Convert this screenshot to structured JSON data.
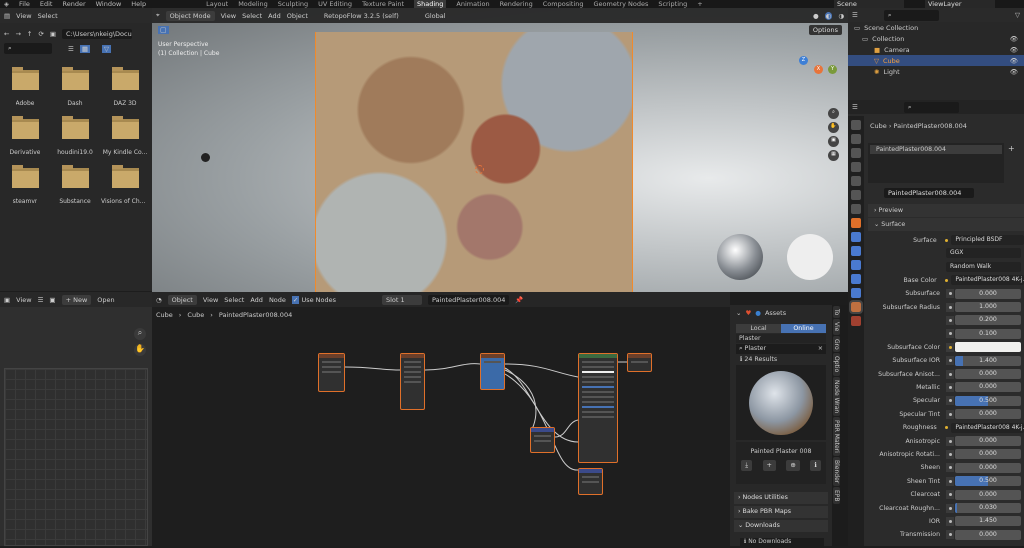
{
  "topbar": {
    "menus": [
      "File",
      "Edit",
      "Render",
      "Window",
      "Help"
    ],
    "workspaces": [
      "Layout",
      "Modeling",
      "Sculpting",
      "UV Editing",
      "Texture Paint",
      "Shading",
      "Animation",
      "Rendering",
      "Compositing",
      "Geometry Nodes",
      "Scripting"
    ],
    "active": "Shading",
    "scene": "Scene",
    "view_layer": "ViewLayer"
  },
  "filebrowser": {
    "menus": [
      "View",
      "Select"
    ],
    "path": "C:\\Users\\nkeig\\Docum...",
    "folders": [
      "Adobe",
      "Dash",
      "DAZ 3D",
      "Derivative",
      "houdini19.0",
      "My Kindle Co...",
      "steamvr",
      "Substance",
      "Visions of Cha..."
    ]
  },
  "viewport": {
    "mode": "Object Mode",
    "menus": [
      "View",
      "Select",
      "Add",
      "Object"
    ],
    "addon": "RetopoFlow 3.2.5 (self)",
    "orientation": "Global",
    "options": "Options",
    "perspective": "User Perspective",
    "collection": "(1) Collection | Cube",
    "gizmo": {
      "z": "Z",
      "x": "X",
      "y": "Y"
    }
  },
  "outliner": {
    "root": "Scene Collection",
    "collection": "Collection",
    "items": [
      "Camera",
      "Cube",
      "Light"
    ],
    "selected": "Cube"
  },
  "properties": {
    "breadcrumb_object": "Cube",
    "breadcrumb_material": "PaintedPlaster008.004",
    "slot": "PaintedPlaster008.004",
    "material": "PaintedPlaster008.004",
    "preview": "Preview",
    "surface_panel": "Surface",
    "rows": [
      {
        "label": "Surface",
        "type": "link",
        "value": "Principled BSDF"
      },
      {
        "label": "",
        "type": "enum",
        "value": "GGX"
      },
      {
        "label": "",
        "type": "enum",
        "value": "Random Walk"
      },
      {
        "label": "Base Color",
        "type": "link",
        "value": "PaintedPlaster008 4K-j..."
      },
      {
        "label": "Subsurface",
        "type": "value",
        "value": "0.000",
        "fill": 0
      },
      {
        "label": "Subsurface Radius",
        "type": "value",
        "value": "1.000",
        "fill": 0
      },
      {
        "label": "",
        "type": "value",
        "value": "0.200",
        "fill": 0
      },
      {
        "label": "",
        "type": "value",
        "value": "0.100",
        "fill": 0
      },
      {
        "label": "Subsurface Color",
        "type": "color",
        "value": "#f0f0ee"
      },
      {
        "label": "Subsurface IOR",
        "type": "value",
        "value": "1.400",
        "fill": 0.12
      },
      {
        "label": "Subsurface Anisot...",
        "type": "value",
        "value": "0.000",
        "fill": 0
      },
      {
        "label": "Metallic",
        "type": "value",
        "value": "0.000",
        "fill": 0
      },
      {
        "label": "Specular",
        "type": "value",
        "value": "0.500",
        "fill": 0.5
      },
      {
        "label": "Specular Tint",
        "type": "value",
        "value": "0.000",
        "fill": 0
      },
      {
        "label": "Roughness",
        "type": "link",
        "value": "PaintedPlaster008 4K-j..."
      },
      {
        "label": "Anisotropic",
        "type": "value",
        "value": "0.000",
        "fill": 0
      },
      {
        "label": "Anisotropic Rotati...",
        "type": "value",
        "value": "0.000",
        "fill": 0
      },
      {
        "label": "Sheen",
        "type": "value",
        "value": "0.000",
        "fill": 0
      },
      {
        "label": "Sheen Tint",
        "type": "value",
        "value": "0.500",
        "fill": 0.5
      },
      {
        "label": "Clearcoat",
        "type": "value",
        "value": "0.000",
        "fill": 0
      },
      {
        "label": "Clearcoat Roughn...",
        "type": "value",
        "value": "0.030",
        "fill": 0.03
      },
      {
        "label": "IOR",
        "type": "value",
        "value": "1.450",
        "fill": 0
      },
      {
        "label": "Transmission",
        "type": "value",
        "value": "0.000",
        "fill": 0
      }
    ]
  },
  "imageeditor": {
    "view": "View",
    "new": "New",
    "open": "Open"
  },
  "nodeeditor": {
    "type": "Object",
    "menus": [
      "View",
      "Select",
      "Add",
      "Node"
    ],
    "use_nodes": "Use Nodes",
    "slot": "Slot 1",
    "material": "PaintedPlaster008.004",
    "breadcrumb": [
      "Cube",
      "Cube",
      "PaintedPlaster008.004"
    ]
  },
  "assets": {
    "title": "Assets",
    "tabs": [
      "Local",
      "Online"
    ],
    "active_tab": "Online",
    "category": "Plaster",
    "search": "Plaster",
    "results": "24 Results",
    "asset_name": "Painted Plaster 008",
    "panels": [
      "Nodes Utilities",
      "Bake PBR Maps",
      "Downloads"
    ],
    "downloads": "No Downloads"
  },
  "vtabs": [
    "To",
    "Vie",
    "Gro",
    "Optio",
    "Node Wran",
    "PBR Materi",
    "Blender",
    "EPB"
  ]
}
